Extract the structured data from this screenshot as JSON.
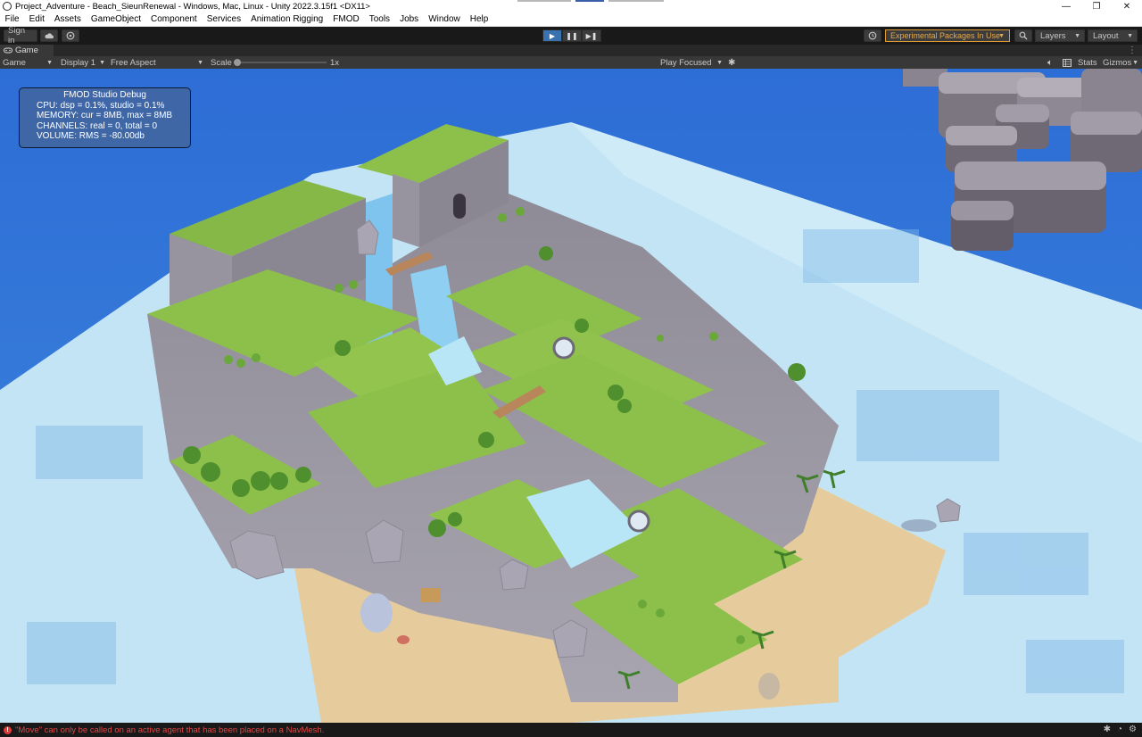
{
  "window": {
    "title": "Project_Adventure - Beach_SieunRenewal - Windows, Mac, Linux - Unity 2022.3.15f1 <DX11>",
    "controls": [
      "—",
      "❐",
      "✕"
    ]
  },
  "menu": [
    "File",
    "Edit",
    "Assets",
    "GameObject",
    "Component",
    "Services",
    "Animation Rigging",
    "FMOD",
    "Tools",
    "Jobs",
    "Window",
    "Help"
  ],
  "toolbar": {
    "sign_in": "Sign in",
    "cloud_icon": "cloud-icon",
    "collab_icon": "collab-icon",
    "play": "▶",
    "pause": "❚❚",
    "step": "▶❚",
    "history_icon": "history-icon",
    "experimental_packages": "Experimental Packages In Use",
    "search_icon": "search-icon",
    "layers": "Layers",
    "layout": "Layout"
  },
  "game_tab": {
    "label": "Game"
  },
  "game_bar": {
    "mode": "Game",
    "display": "Display 1",
    "aspect": "Free Aspect",
    "scale_label": "Scale",
    "scale_value": "1x",
    "play_mode": "Play Focused",
    "stats": "Stats",
    "gizmos": "Gizmos"
  },
  "fmod_debug": {
    "title": "FMOD Studio Debug",
    "lines": [
      "CPU: dsp = 0.1%, studio = 0.1%",
      "MEMORY: cur = 8MB, max = 8MB",
      "CHANNELS: real = 0, total = 0",
      "VOLUME: RMS = -80.00db"
    ]
  },
  "status": {
    "error": "\"Move\" can only be called on an active agent that has been placed on a NavMesh."
  },
  "colors": {
    "sky": "#2f6fd0",
    "water": "#bfe3f5",
    "grass": "#8cc04a",
    "stone": "#9b97a3",
    "sand": "#e8cfa0",
    "accent_play": "#3a72b0",
    "warning": "#e09a30",
    "error": "#e04848"
  }
}
